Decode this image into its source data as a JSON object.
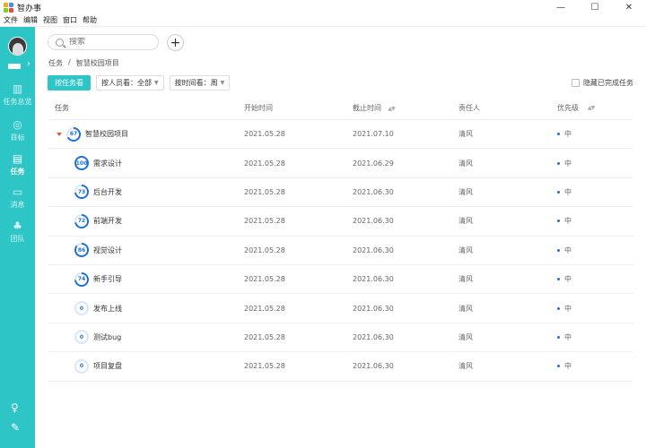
{
  "app": {
    "title": "智办事",
    "window_controls": {
      "minimize": "—",
      "maximize": "☐",
      "close": "✕"
    },
    "menu": [
      "文件",
      "编辑",
      "视图",
      "窗口",
      "帮助"
    ]
  },
  "sidebar": {
    "nav": [
      {
        "label": "任务总览",
        "icon": "chart-icon"
      },
      {
        "label": "目标",
        "icon": "target-icon"
      },
      {
        "label": "任务",
        "icon": "task-icon",
        "active": true
      },
      {
        "label": "消息",
        "icon": "message-icon"
      },
      {
        "label": "团队",
        "icon": "team-icon"
      }
    ],
    "bottom_icons": [
      "add-member-icon",
      "edit-icon"
    ]
  },
  "search": {
    "placeholder": "搜索"
  },
  "breadcrumb": {
    "root": "任务",
    "sep": "/",
    "current": "智慧校园项目"
  },
  "filters": {
    "by_task": "按任务看",
    "by_person": "按人员看：全部",
    "by_time": "按时间看：周",
    "hide_done": "隐藏已完成任务"
  },
  "table": {
    "headers": {
      "task": "任务",
      "start": "开始时间",
      "end": "截止时间",
      "owner": "责任人",
      "priority": "优先级"
    },
    "sort_glyph": "▲▼",
    "parent": {
      "progress": 67,
      "name": "智慧校园项目",
      "start": "2021.05.28",
      "end": "2021.07.10",
      "owner": "清风",
      "priority": "中"
    },
    "rows": [
      {
        "progress": 100,
        "name": "需求设计",
        "start": "2021.05.28",
        "end": "2021.06.29",
        "owner": "清风",
        "priority": "中"
      },
      {
        "progress": 73,
        "name": "后台开发",
        "start": "2021.05.28",
        "end": "2021.06.30",
        "owner": "清风",
        "priority": "中"
      },
      {
        "progress": 72,
        "name": "前端开发",
        "start": "2021.05.28",
        "end": "2021.06.30",
        "owner": "清风",
        "priority": "中"
      },
      {
        "progress": 86,
        "name": "视觉设计",
        "start": "2021.05.28",
        "end": "2021.06.30",
        "owner": "清风",
        "priority": "中"
      },
      {
        "progress": 74,
        "name": "新手引导",
        "start": "2021.05.28",
        "end": "2021.06.30",
        "owner": "清风",
        "priority": "中"
      },
      {
        "progress": 0,
        "name": "发布上线",
        "start": "2021.05.28",
        "end": "2021.06.30",
        "owner": "清风",
        "priority": "中"
      },
      {
        "progress": 0,
        "name": "测试bug",
        "start": "2021.05.28",
        "end": "2021.06.30",
        "owner": "清风",
        "priority": "中"
      },
      {
        "progress": 0,
        "name": "项目复盘",
        "start": "2021.05.28",
        "end": "2021.06.30",
        "owner": "清风",
        "priority": "中"
      }
    ]
  },
  "colors": {
    "accent": "#2ec5c7",
    "progress": "#1e6fd9",
    "progress_track": "#d9e6f7"
  }
}
